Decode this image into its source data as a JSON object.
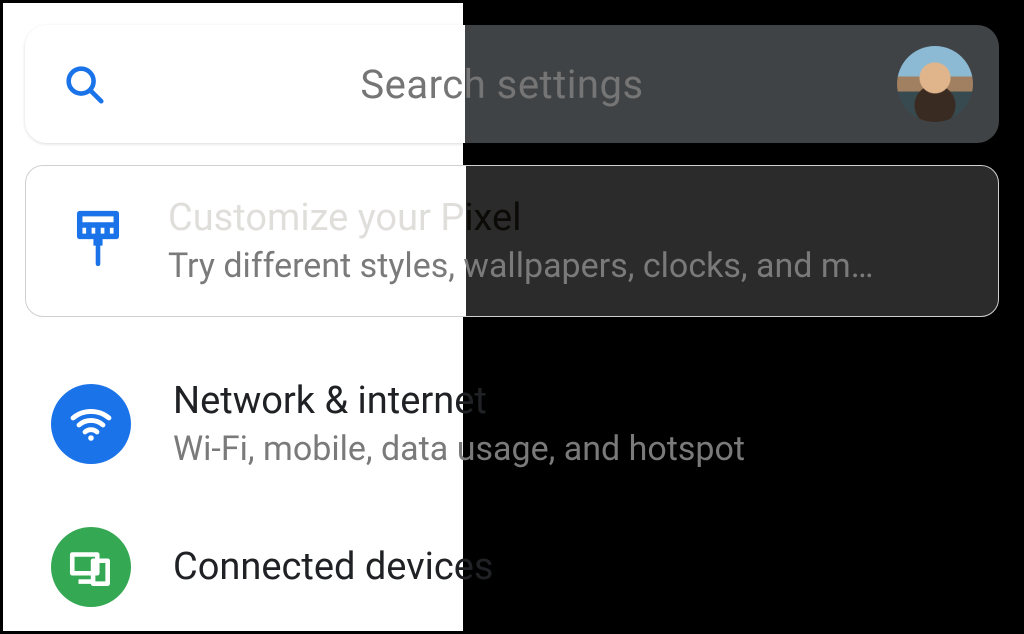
{
  "search": {
    "placeholder": "Search settings"
  },
  "customize": {
    "title": "Customize your Pixel",
    "subtitle": "Try different styles, wallpapers, clocks, and m…"
  },
  "rows": {
    "network": {
      "title": "Network & internet",
      "subtitle": "Wi-Fi, mobile, data usage, and hotspot"
    },
    "connected": {
      "title": "Connected devices"
    }
  }
}
